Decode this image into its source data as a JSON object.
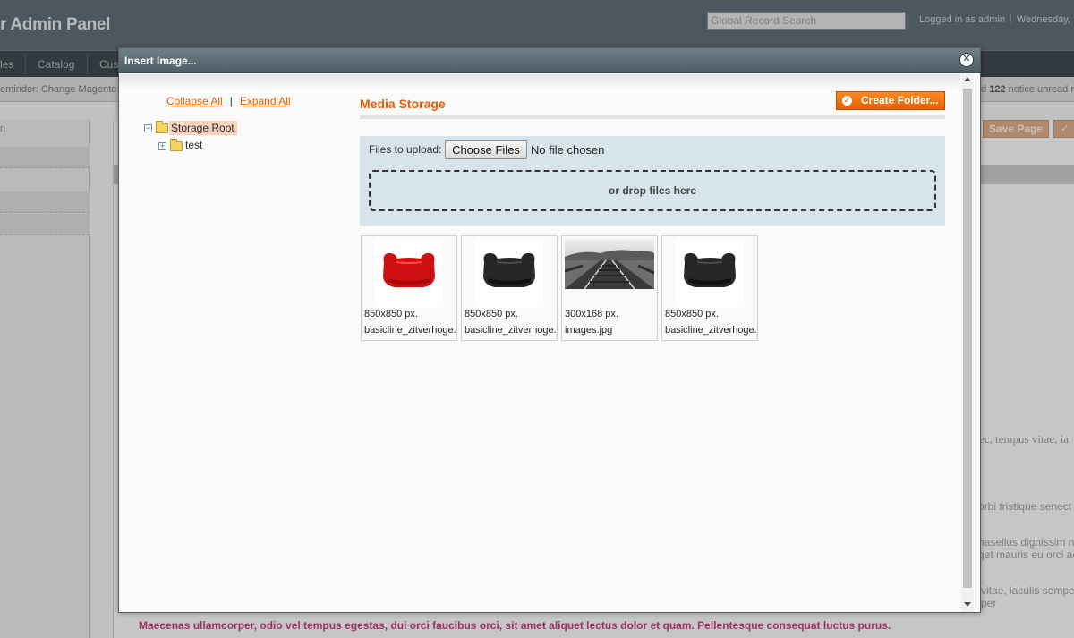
{
  "background": {
    "brand": "r Admin Panel",
    "global_search_placeholder": "Global Record Search",
    "logged_in": "Logged in as admin",
    "date_text": "Wednesday,",
    "nav": [
      "les",
      "Catalog",
      "Cus"
    ],
    "reminder": "eminder: Change Magento",
    "notice_prefix": "d",
    "notice_count": "122",
    "notice_suffix": "notice unread r",
    "save_page": "Save Page",
    "body_text_1": "ec, tempus vitae, ia",
    "body_text_2": "orbi tristique senect",
    "body_text_3": "hasellus dignissim n",
    "body_text_4": "get mauris eu orci ac",
    "body_text_5": "vitae, iaculis sempe",
    "body_text_6": "per",
    "pink_text": "Maecenas ullamcorper, odio vel tempus egestas, dui orci faucibus orci, sit amet aliquet lectus dolor et quam. Pellentesque consequat luctus purus."
  },
  "dialog": {
    "title": "Insert Image...",
    "close_glyph": "✕",
    "tree": {
      "collapse_all": "Collapse All",
      "separator": "|",
      "expand_all": "Expand All",
      "root_label": "Storage Root",
      "child_label": "test"
    },
    "media": {
      "title": "Media Storage",
      "create_folder": "Create Folder...",
      "files_to_upload": "Files to upload:",
      "choose_files": "Choose Files",
      "no_file": "No file chosen",
      "drop_text": "or drop files here"
    },
    "thumbnails": [
      {
        "dimensions": "850x850 px.",
        "name": "basicline_zitverhoge.",
        "color": "#d01010"
      },
      {
        "dimensions": "850x850 px.",
        "name": "basicline_zitverhoge.",
        "color": "#262626"
      },
      {
        "dimensions": "300x168 px.",
        "name": "images.jpg",
        "color": "#555555"
      },
      {
        "dimensions": "850x850 px.",
        "name": "basicline_zitverhoge.",
        "color": "#262626"
      }
    ]
  }
}
